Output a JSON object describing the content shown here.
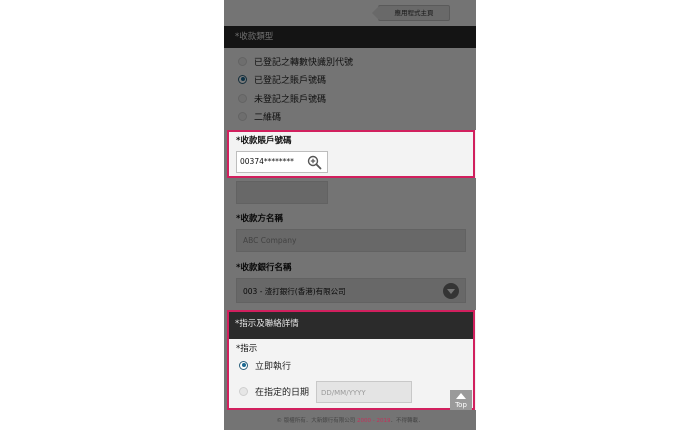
{
  "header": {
    "home_label": "應用程式主頁"
  },
  "payee_type": {
    "title": "*收款類型",
    "options": [
      {
        "label": "已登記之轉數快識別代號",
        "selected": false
      },
      {
        "label": "已登記之賬戶號碼",
        "selected": true
      },
      {
        "label": "未登記之賬戶號碼",
        "selected": false
      },
      {
        "label": "二維碼",
        "selected": false
      }
    ]
  },
  "account": {
    "label": "*收款賬戶號碼",
    "value": "00374********",
    "search_icon": "magnifier-plus-icon"
  },
  "payee_name": {
    "label": "*收款方名稱",
    "value": "ABC Company"
  },
  "bank": {
    "label": "*收款銀行名稱",
    "value": "003 - 渣打銀行(香港)有限公司",
    "icon": "chevron-down-icon"
  },
  "instructions": {
    "title": "*指示及聯絡詳情",
    "sub_label": "*指示",
    "options": [
      {
        "label": "立即執行",
        "selected": true
      },
      {
        "label": "在指定的日期",
        "selected": false
      }
    ],
    "date_placeholder": "DD/MM/YYYY"
  },
  "top_button": {
    "label": "Top"
  },
  "footer": {
    "prefix": "© 版權所有．大新銀行有限公司 ",
    "years": "2000 - 2019",
    "suffix": "．不得轉載．"
  },
  "colors": {
    "highlight": "#d1205e",
    "dark_bar": "#2b2b2b",
    "radio_selected": "#1c6a92"
  }
}
